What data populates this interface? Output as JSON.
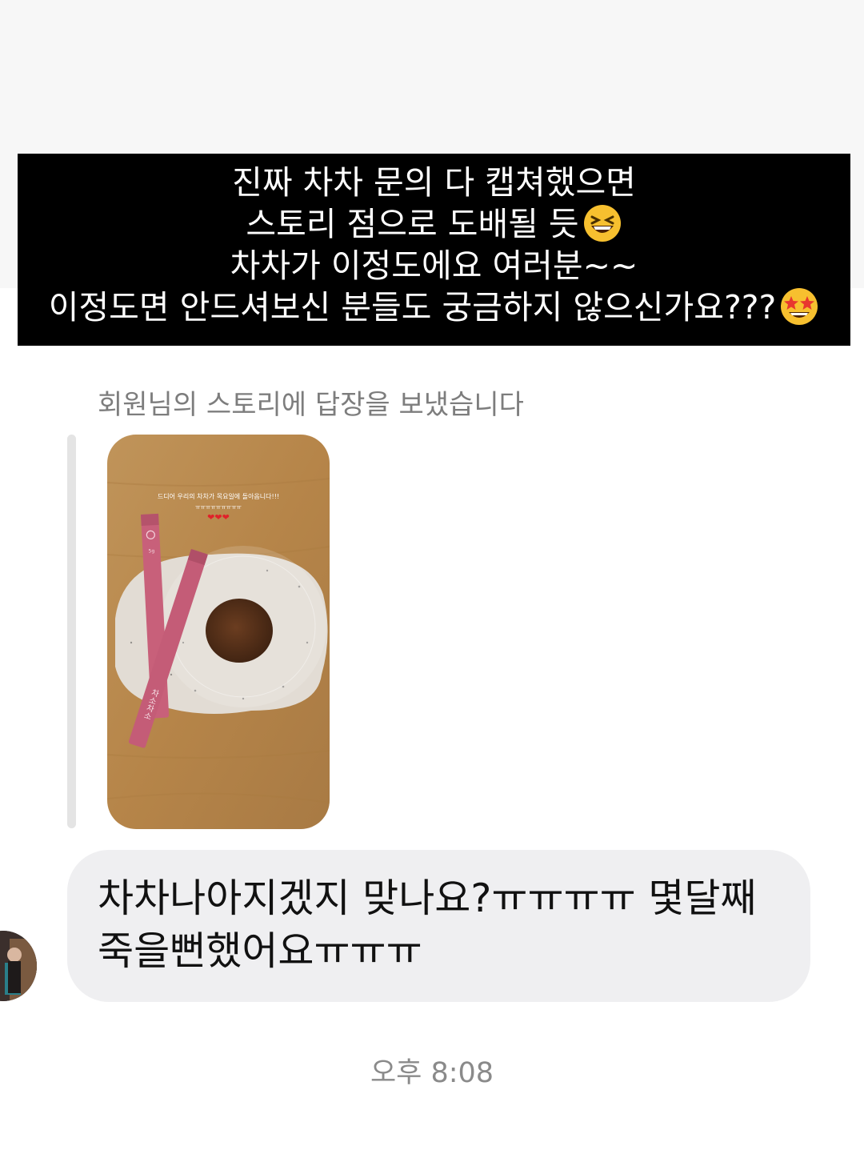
{
  "caption": {
    "lines": [
      "진짜 차차 문의 다 캡쳐했으면",
      "스토리 점으로 도배될 듯",
      "차차가 이정도에요 여러분~~",
      "이정도면 안드셔보신 분들도 궁금하지 않으신가요???"
    ],
    "emoji_line2": "grinning-squinting-face",
    "emoji_line4": "star-struck-face"
  },
  "reply_note": "회원님의 스토리에 답장을 보냈습니다",
  "story": {
    "overlay_text": "드디어 우리의 차차가 목요일에 돌아옵니다!!!",
    "overlay_sub": "ㅠㅠㅠㅠㅠㅠㅠㅠㅠ",
    "overlay_hearts": "❤❤❤",
    "product_label": "차소차소",
    "product_size": "5g"
  },
  "message": {
    "text": "차차나아지겠지 맞나요?ㅠㅠㅠㅠ 몇달째 죽을뻔했어요ㅠㅠㅠ"
  },
  "timestamp": "오후 8:08",
  "colors": {
    "caption_bg": "#000000",
    "caption_text": "#ffffff",
    "bubble_bg": "#efeff1",
    "note_text": "#7d7d7d",
    "wood": "#b98a50",
    "stick_pink": "#c8607a"
  }
}
